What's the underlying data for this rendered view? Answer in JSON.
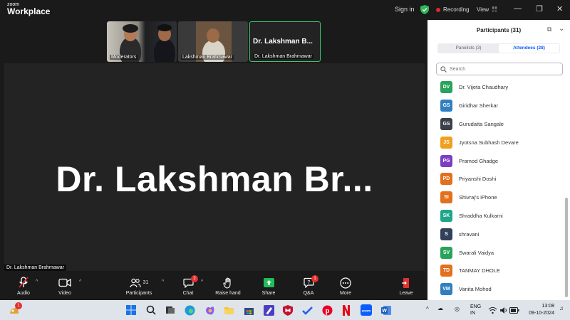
{
  "app": {
    "logo_small": "zoom",
    "logo_big": "Workplace",
    "sign_in": "Sign in",
    "recording": "Recording",
    "view": "View"
  },
  "thumbnails": [
    {
      "name": "Moderators"
    },
    {
      "name": "Lakshman Brahmawar"
    },
    {
      "big_name": "Dr. Lakshman B...",
      "name": "Dr. Lakshman Brahmawar"
    }
  ],
  "stage": {
    "speaker_display": "Dr. Lakshman Br...",
    "name_label": "Dr. Lakshman Brahmawar"
  },
  "toolbar": {
    "audio": "Audio",
    "video": "Video",
    "participants": "Participants",
    "participants_count": "31",
    "chat": "Chat",
    "chat_badge": "2",
    "raise_hand": "Raise hand",
    "share": "Share",
    "qa": "Q&A",
    "qa_badge": "1",
    "more": "More",
    "leave": "Leave"
  },
  "panel": {
    "title": "Participants (31)",
    "tab_panelists": "Panelists (3)",
    "tab_attendees": "Attendees (28)",
    "search_placeholder": "Search",
    "attendees": [
      {
        "initials": "DV",
        "name": "Dr. Vijeta Chaudhary",
        "color": "#27a35a"
      },
      {
        "initials": "GS",
        "name": "Giridhar Sherkar",
        "color": "#2f7fc1"
      },
      {
        "initials": "GS",
        "name": "Gurudatta Sangale",
        "color": "#3a3f4a"
      },
      {
        "initials": "JS",
        "name": "Jyotsna Subhash Devare",
        "color": "#f0a020"
      },
      {
        "initials": "PG",
        "name": "Pramod Ghadge",
        "color": "#7b3fc2"
      },
      {
        "initials": "PD",
        "name": "Priyanshi Doshi",
        "color": "#e2701c"
      },
      {
        "initials": "SI",
        "name": "Shivraj's iPhone",
        "color": "#e2701c"
      },
      {
        "initials": "SK",
        "name": "Shraddha Kulkarni",
        "color": "#1ea58a"
      },
      {
        "initials": "S",
        "name": "shravani",
        "color": "#33405a"
      },
      {
        "initials": "SV",
        "name": "Swarali Vaidya",
        "color": "#27a35a"
      },
      {
        "initials": "TD",
        "name": "TANMAY DHOLE",
        "color": "#e2701c"
      },
      {
        "initials": "VM",
        "name": "Vanita Mohod",
        "color": "#2f7fc1"
      }
    ]
  },
  "taskbar": {
    "notification_badge": "1",
    "lang_line1": "ENG",
    "lang_line2": "IN",
    "time": "13:08",
    "date": "09-10-2024"
  },
  "colors": {
    "accent_blue": "#0b5cff",
    "active_green": "#3ec56e",
    "share_green": "#1fbf57",
    "badge_red": "#e0312f",
    "leave_red": "#e0312f"
  }
}
